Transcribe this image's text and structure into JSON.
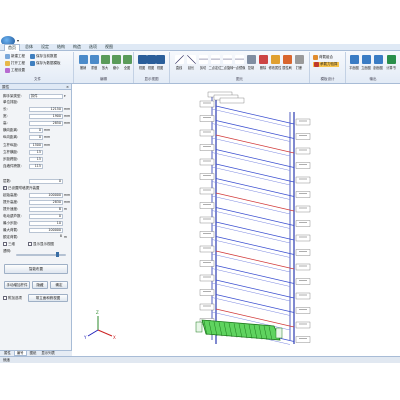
{
  "app": {
    "tabs": [
      "首页",
      "总体",
      "设定",
      "结构",
      "构造",
      "选项",
      "视图"
    ],
    "active_tab_index": 0
  },
  "ribbon": {
    "file_group": {
      "title": "文件",
      "items": [
        "新建工程",
        "打开工程",
        "工程设置",
        "保存当前数据",
        "保存为数据模板"
      ]
    },
    "edit_group": {
      "title": "编辑",
      "items": [
        "撤销",
        "重做",
        "放大",
        "缩小",
        "全图"
      ]
    },
    "view_group": {
      "title": "显示视图",
      "items": [
        "视图",
        "视图",
        "视图",
        "视图"
      ]
    },
    "draw_group": {
      "title": "图元",
      "items": [
        "直线",
        "延长",
        "剪切",
        "二点定位",
        "二点旋转",
        "一点镜像",
        "复制",
        "删除",
        "修改属性",
        "属性刷",
        "打断",
        "合并",
        "查询信息",
        "图元显隐"
      ]
    },
    "calc_group": {
      "title": "模板设计",
      "items": [
        "荷载组合",
        "承载力验算"
      ]
    },
    "output_group": {
      "title": "输出",
      "items": [
        "平面图",
        "立面图",
        "剖面图",
        "计算书"
      ]
    }
  },
  "panel": {
    "title": "属性",
    "close_glyph": "×",
    "rows": [
      {
        "label": "脚手架类型:",
        "value": "扣件",
        "unit": ""
      },
      {
        "label": "单位排距:",
        "value": "",
        "unit": ""
      },
      {
        "label": "长:",
        "value": "12150",
        "unit": "mm"
      },
      {
        "label": "宽:",
        "value": "1900",
        "unit": "mm"
      },
      {
        "label": "高:",
        "value": "2850",
        "unit": "mm"
      },
      {
        "label": "横向距离:",
        "value": "0",
        "unit": "mm"
      },
      {
        "label": "纵向距离:",
        "value": "0",
        "unit": "mm"
      },
      {
        "label": "立杆纵距:",
        "value": "1500",
        "unit": "mm"
      },
      {
        "label": "立杆横距:",
        "value": "15",
        "unit": ""
      },
      {
        "label": "步距跨距:",
        "value": "15",
        "unit": ""
      },
      {
        "label": "连墙件跨数:",
        "value": "115",
        "unit": ""
      }
    ],
    "rows2": [
      {
        "label": "层数:",
        "value": "0",
        "unit": ""
      }
    ],
    "check1": "已设置附墙提升装置",
    "rows3": [
      {
        "label": "起始高度:",
        "value": "100000",
        "unit": "mm"
      },
      {
        "label": "提升高度:",
        "value": "2830",
        "unit": "mm"
      },
      {
        "label": "提升速度:",
        "value": "8",
        "unit": "m"
      },
      {
        "label": "电动葫芦数:",
        "value": "0",
        "unit": ""
      },
      {
        "label": "最小步距:",
        "value": "10",
        "unit": ""
      },
      {
        "label": "最大荷载:",
        "value": "100000",
        "unit": ""
      },
      {
        "label": "额定荷载:",
        "value": "8",
        "unit": "m"
      }
    ],
    "check2": "三维",
    "check3": "显示显示视图",
    "slider_label": "透明:",
    "primary_button": "智能布置",
    "btn_a": "手动增加杆件",
    "btn_b": "隐藏",
    "btn_c": "确定",
    "check4": "附加选项",
    "btn_d": "带立面和俯视图"
  },
  "panel_tabs": [
    "属性",
    "编号",
    "图纸",
    "显示列表"
  ],
  "status": {
    "text": "就绪"
  },
  "canvas": {
    "axis_x": "X",
    "axis_y": "Y",
    "axis_z": "Z",
    "label_text": "扣件 0.00m"
  }
}
